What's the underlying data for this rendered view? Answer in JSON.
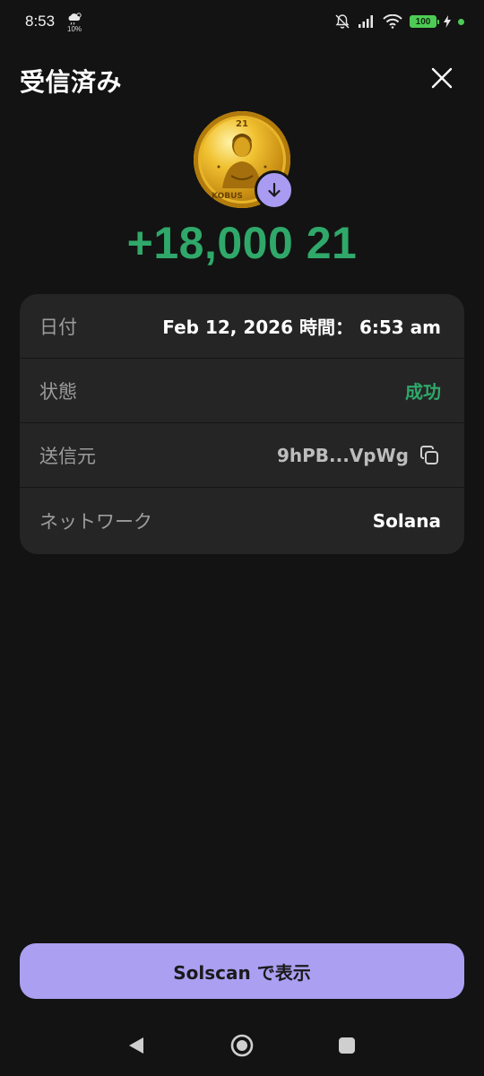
{
  "status_bar": {
    "time": "8:53",
    "weather_percent": "10%",
    "battery": "100"
  },
  "header": {
    "title": "受信済み"
  },
  "transaction": {
    "amount": "+18,000 21"
  },
  "coin": {
    "top_text": "21",
    "bottom_text": "KOBUS"
  },
  "details": [
    {
      "label": "日付",
      "value": "Feb 12, 2026 時間： 6:53 am"
    },
    {
      "label": "状態",
      "value": "成功"
    },
    {
      "label": "送信元",
      "value": "9hPB...VpWg"
    },
    {
      "label": "ネットワーク",
      "value": "Solana"
    }
  ],
  "actions": {
    "solscan_label": "Solscan で表示"
  },
  "colors": {
    "background": "#131313",
    "card": "#252525",
    "success": "#2fa86a",
    "accent": "#ab9ff2"
  },
  "icons": {
    "close": "close-icon",
    "receive": "arrow-down-icon",
    "copy": "copy-icon",
    "nav_back": "back-triangle-icon",
    "nav_home": "home-circle-icon",
    "nav_recents": "recents-square-icon"
  }
}
